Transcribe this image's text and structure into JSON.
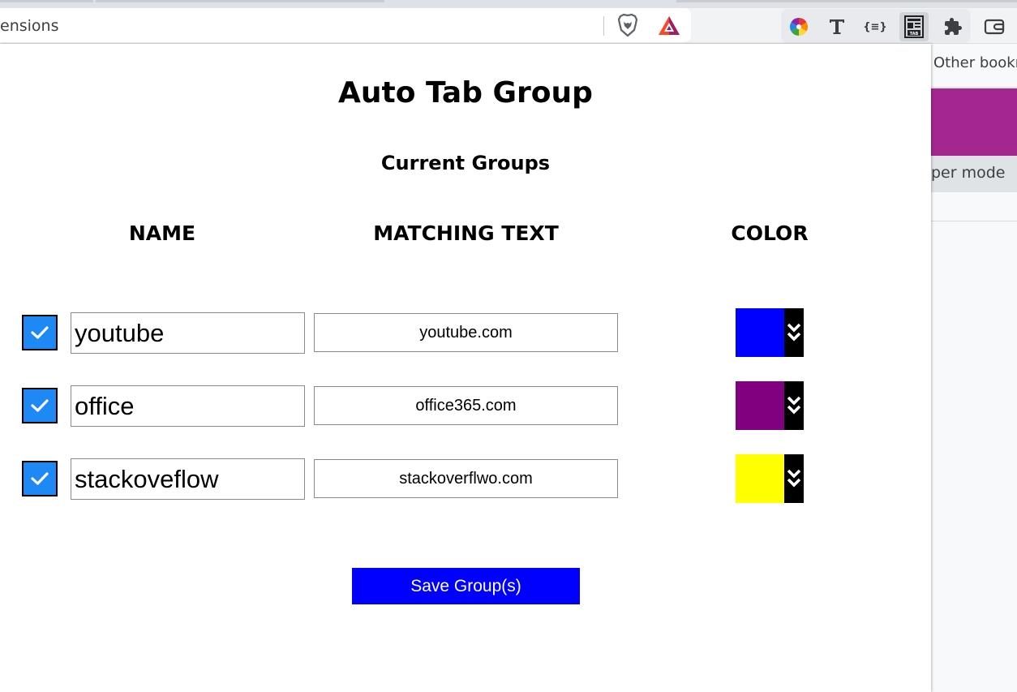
{
  "browser": {
    "omnibox_text": "ensions",
    "bookmarks_text": "Other bookm",
    "bg_mode_text": "per mode",
    "extensions": [
      {
        "name": "color-wheel-icon"
      },
      {
        "name": "text-t-icon"
      },
      {
        "name": "json-braces-icon",
        "label": "{≡}"
      },
      {
        "name": "auto-tab-group-icon"
      },
      {
        "name": "puzzle-piece-icon"
      }
    ]
  },
  "popup": {
    "title": "Auto Tab Group",
    "subtitle": "Current Groups",
    "headers": {
      "name": "NAME",
      "matching_text": "MATCHING TEXT",
      "color": "COLOR"
    },
    "groups": [
      {
        "enabled": true,
        "name": "youtube",
        "matching_text": "youtube.com",
        "color": "#0000ff"
      },
      {
        "enabled": true,
        "name": "office",
        "matching_text": "office365.com",
        "color": "#800080"
      },
      {
        "enabled": true,
        "name": "stackoveflow",
        "matching_text": "stackoverflwo.com",
        "color": "#ffff00"
      }
    ],
    "save_label": "Save Group(s)"
  }
}
